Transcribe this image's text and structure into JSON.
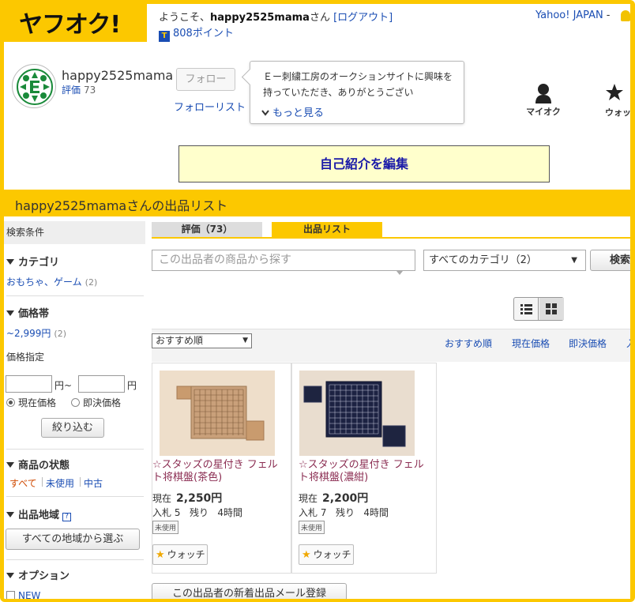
{
  "header": {
    "logo": "ヤフオク!",
    "welcome_prefix": "ようこそ、",
    "username": "happy2525mama",
    "welcome_suffix": "さん",
    "logout": "[ログアウト]",
    "points_icon": "T",
    "points": "808ポイント",
    "yahoo_japan": "Yahoo! JAPAN",
    "yahoo_dash": "-"
  },
  "profile": {
    "name": "happy2525mama",
    "rating_label": "評価",
    "rating_value": "73",
    "follow_button": "フォロー",
    "follow_list": "フォローリスト",
    "bubble_text": "Ｅー刺繍工房のオークションサイトに興味を持っていただき、ありがとうござい",
    "more_link": "もっと見る",
    "my_auction": "マイオク",
    "watch_list": "ウォッチ"
  },
  "edit_intro": "自己紹介を編集",
  "band_title": "happy2525mamaさんの出品リスト",
  "sidebar": {
    "header": "検索条件",
    "category_heading": "カテゴリ",
    "category_link": "おもちゃ、ゲーム",
    "category_count": "(2)",
    "price_heading": "価格帯",
    "price_link": "~2,999円",
    "price_count": "(2)",
    "price_spec": "価格指定",
    "yen_tilde": "円~",
    "yen": "円",
    "radio_current": "現在価格",
    "radio_buynow": "即決価格",
    "narrow_button": "絞り込む",
    "condition_heading": "商品の状態",
    "cond_all": "すべて",
    "cond_unused": "未使用",
    "cond_used": "中古",
    "region_heading": "出品地域",
    "region_help": "?",
    "region_button": "すべての地域から選ぶ",
    "option_heading": "オプション",
    "option_new": "NEW"
  },
  "tabs": {
    "rating": "評価（73）",
    "listing": "出品リスト"
  },
  "search": {
    "placeholder": "この出品者の商品から探す",
    "category": "すべてのカテゴリ（2）",
    "category_arrow": "▼",
    "button": "検索"
  },
  "sort": {
    "selected": "おすすめ順",
    "arrow": "▼",
    "links": [
      "おすすめ順",
      "現在価格",
      "即決価格",
      "入"
    ]
  },
  "items": [
    {
      "title": "☆スタッズの星付き フェルト将棋盤(茶色)",
      "price_label": "現在",
      "price": "2,250円",
      "bids_label": "入札",
      "bids": "5",
      "remaining_label": "残り",
      "remaining": "4時間",
      "badge": "未使用",
      "watch": "ウォッチ",
      "star": "★"
    },
    {
      "title": "☆スタッズの星付き フェルト将棋盤(濃紺)",
      "price_label": "現在",
      "price": "2,200円",
      "bids_label": "入札",
      "bids": "7",
      "remaining_label": "残り",
      "remaining": "4時間",
      "badge": "未使用",
      "watch": "ウォッチ",
      "star": "★"
    }
  ],
  "mail_button": "この出品者の新着出品メール登録",
  "colors": {
    "brand_yellow": "#fcc800",
    "link_blue": "#1a4db3",
    "item_title": "#8b2d52",
    "active_orange": "#d04a02",
    "intro_bg": "#ffffcc"
  }
}
